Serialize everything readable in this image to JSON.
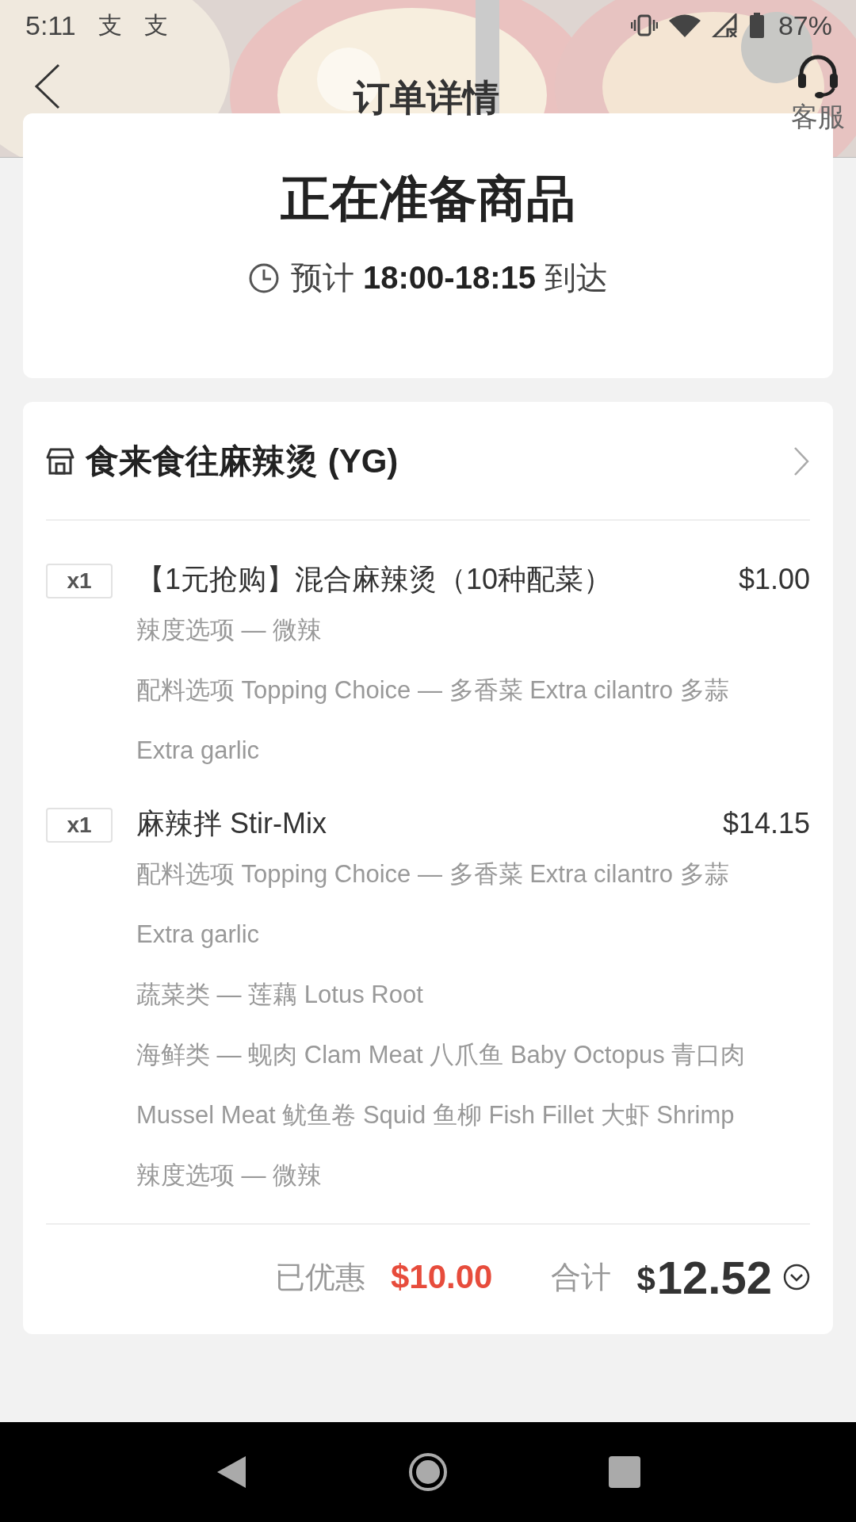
{
  "status_bar": {
    "time": "5:11",
    "notification_icons": [
      "支",
      "支"
    ],
    "battery": "87%"
  },
  "header": {
    "title": "订单详情",
    "service_label": "客服"
  },
  "order_status": {
    "title": "正在准备商品",
    "eta": "预计 **18:00-18:15** 到达"
  },
  "store": {
    "name": "食来食往麻辣烫 (YG)"
  },
  "items": [
    {
      "quantity": "x1",
      "name": "【1元抢购】混合麻辣烫（10种配菜）",
      "price": "$1.00",
      "options": [
        "辣度选项 — 微辣",
        "配料选项 Topping Choice — 多香菜 Extra cilantro 多蒜Extra garlic"
      ]
    },
    {
      "quantity": "x1",
      "name": "麻辣拌 Stir-Mix",
      "price": "$14.15",
      "options": [
        "配料选项 Topping Choice — 多香菜 Extra cilantro 多蒜Extra garlic",
        "蔬菜类 — 莲藕 Lotus Root",
        "海鲜类 — 蚬肉 Clam Meat 八爪鱼 Baby Octopus 青口肉 Mussel Meat 鱿鱼卷 Squid 鱼柳 Fish Fillet 大虾 Shrimp",
        "辣度选项 — 微辣"
      ]
    }
  ],
  "totals": {
    "discount_label": "已优惠",
    "discount": "$10.00",
    "total_label": "合计",
    "total_currency": "$",
    "total": "12.52",
    "expanded": false
  }
}
